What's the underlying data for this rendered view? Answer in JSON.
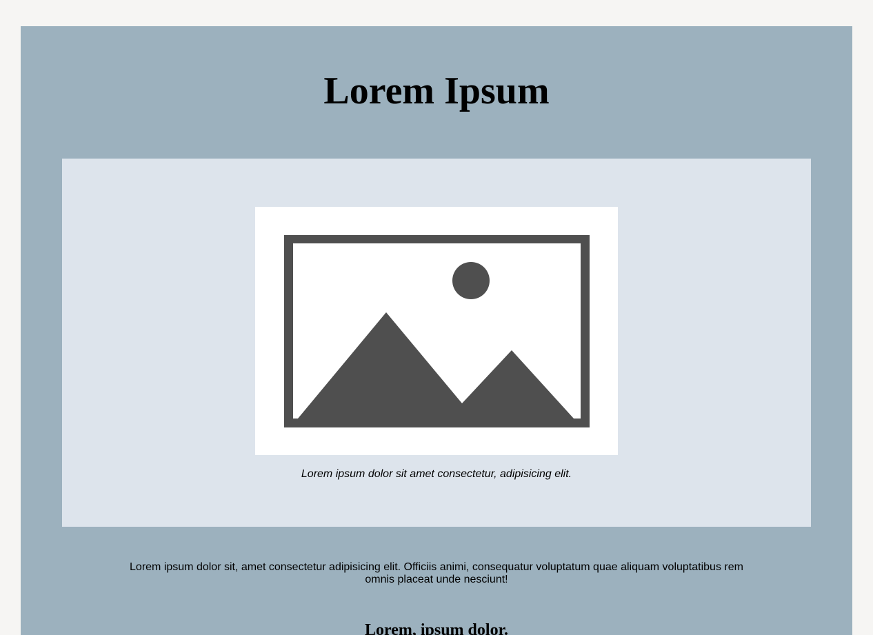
{
  "page": {
    "title": "Lorem Ipsum",
    "figure": {
      "icon": "image-placeholder-icon",
      "caption": "Lorem ipsum dolor sit amet consectetur, adipisicing elit."
    },
    "body_text": "Lorem ipsum dolor sit, amet consectetur adipisicing elit. Officiis animi, consequatur voluptatum quae aliquam voluptatibus rem omnis placeat unde nesciunt!",
    "subheading": "Lorem, ipsum dolor."
  },
  "colors": {
    "background": "#f6f5f3",
    "page": "#9cb1be",
    "figure_panel": "#dde4ec",
    "image_frame": "#ffffff",
    "icon": "#4f4f4f"
  }
}
